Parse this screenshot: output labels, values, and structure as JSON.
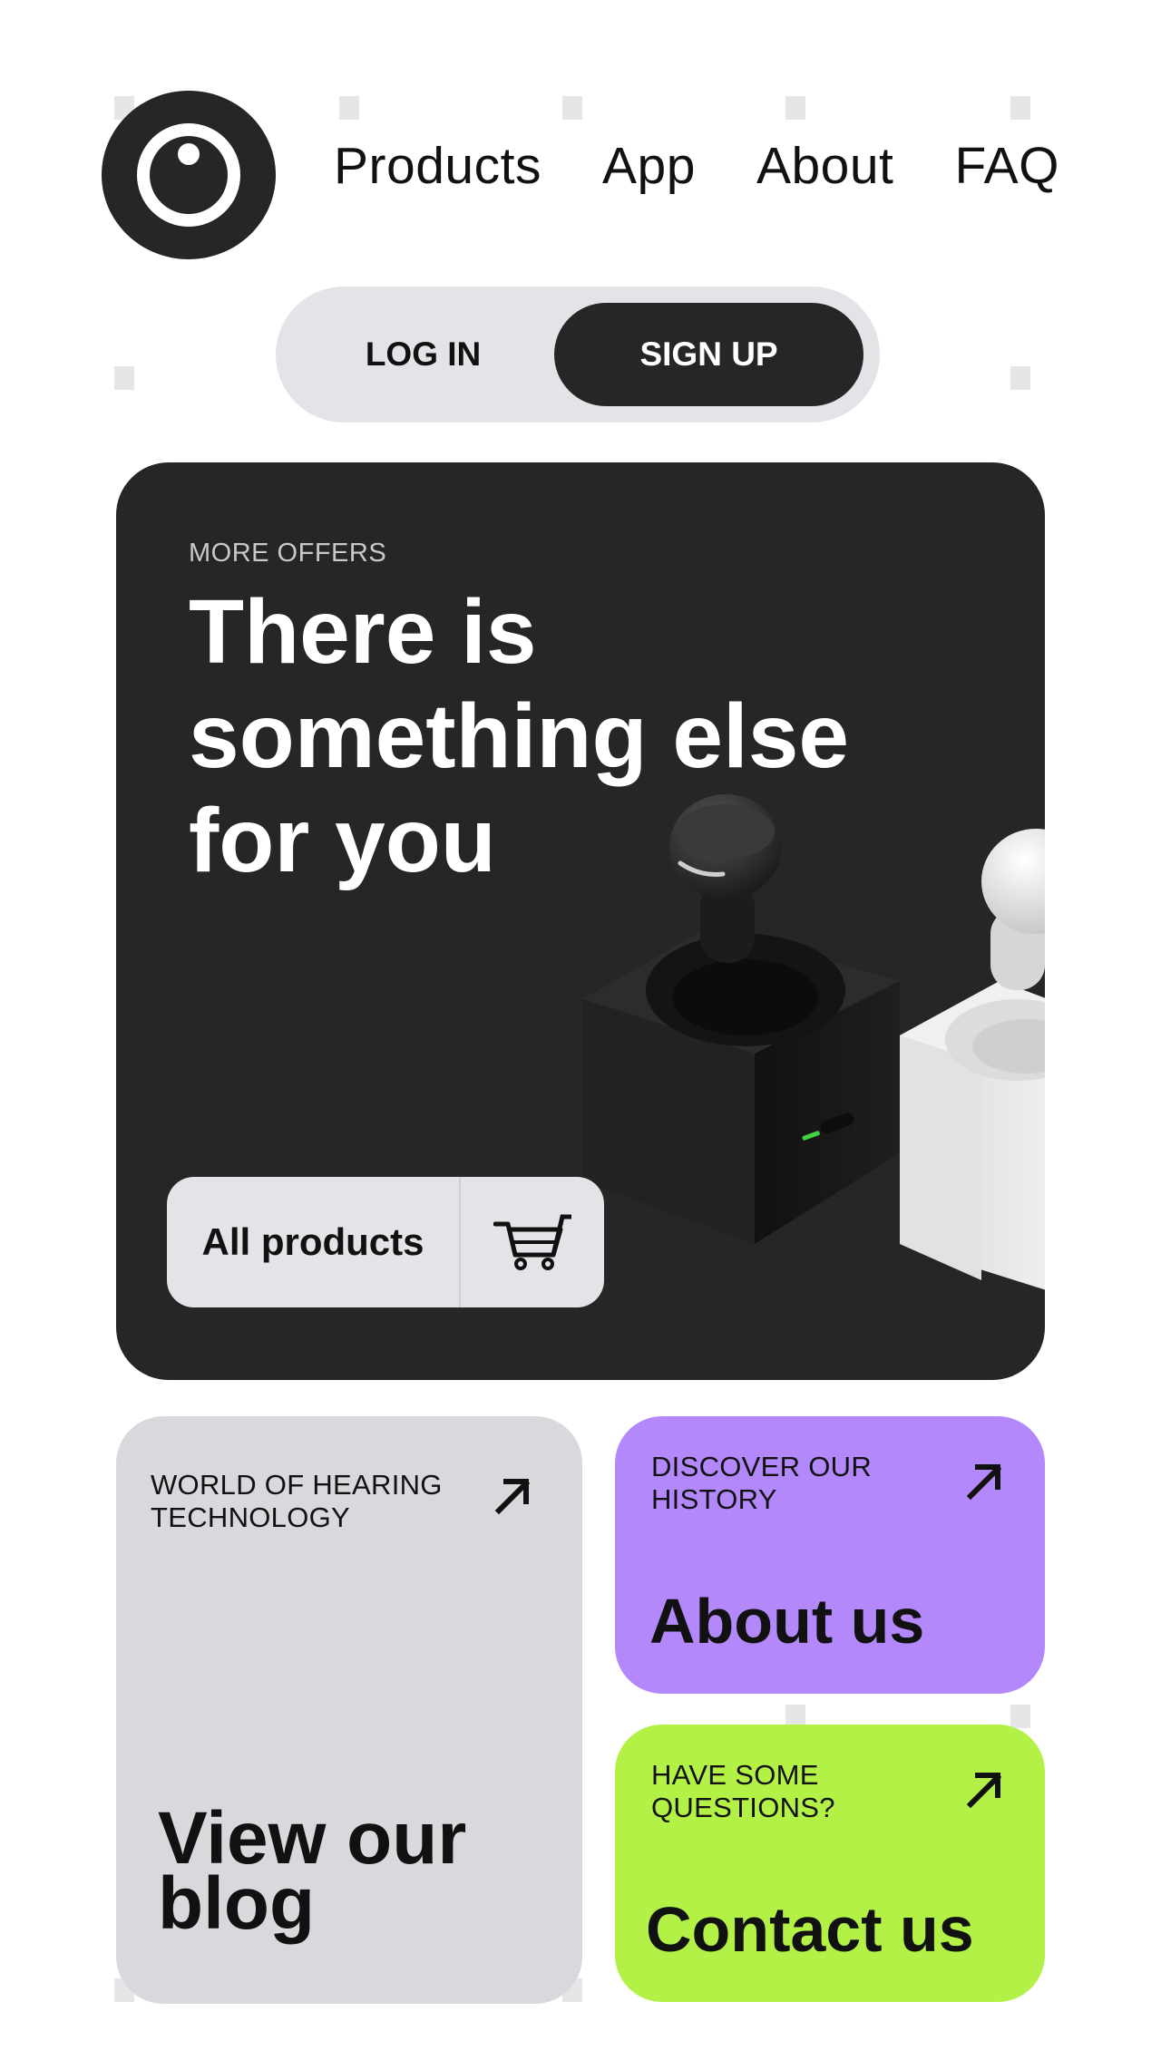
{
  "header": {
    "logo_icon": "eye-logo-icon",
    "nav": [
      {
        "label": "Products"
      },
      {
        "label": "App"
      },
      {
        "label": "About"
      },
      {
        "label": "FAQ"
      }
    ],
    "auth": {
      "login_label": "LOG IN",
      "signup_label": "SIGN UP"
    }
  },
  "hero": {
    "eyebrow": "MORE OFFERS",
    "title": "There is something else for you",
    "cta_label": "All products",
    "cta_icon": "cart-icon",
    "image": "earbuds-charging-docks"
  },
  "cards": {
    "blog": {
      "eyebrow": "WORLD OF HEARING TECHNOLOGY",
      "title": "View our blog",
      "icon": "arrow-up-right-icon"
    },
    "about": {
      "eyebrow": "DISCOVER OUR HISTORY",
      "title": "About us",
      "icon": "arrow-up-right-icon",
      "color": "#b388fb"
    },
    "contact": {
      "eyebrow": "HAVE SOME QUESTIONS?",
      "title": "Contact us",
      "icon": "arrow-up-right-icon",
      "color": "#b3f146"
    }
  },
  "colors": {
    "dark": "#262626",
    "light_gray": "#e3e4e7",
    "purple": "#b388fb",
    "lime": "#b3f146"
  }
}
